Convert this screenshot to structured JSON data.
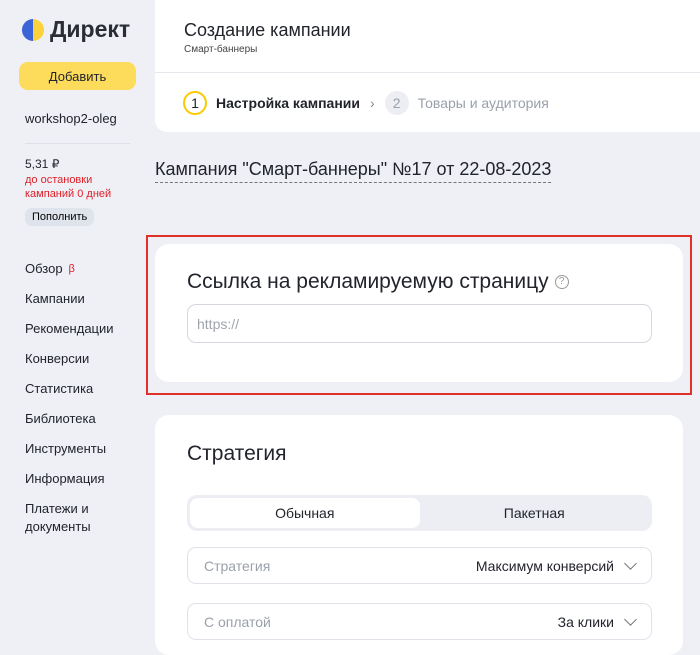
{
  "sidebar": {
    "logo": "Директ",
    "add": "Добавить",
    "login": "workshop2-oleg",
    "balance": "5,31 ₽",
    "warning": "до остановки кампаний 0 дней",
    "topup": "Пополнить",
    "nav": [
      "Обзор",
      "Кампании",
      "Рекомендации",
      "Конверсии",
      "Статистика",
      "Библиотека",
      "Инструменты",
      "Информация",
      "Платежи и документы"
    ],
    "beta": "β"
  },
  "header": {
    "title": "Создание кампании",
    "subtitle": "Смарт-баннеры",
    "steps": [
      {
        "num": "1",
        "label": "Настройка кампании"
      },
      {
        "num": "2",
        "label": "Товары и аудитория"
      }
    ]
  },
  "campaign_name": "Кампания \"Смарт-баннеры\" №17 от 22-08-2023",
  "link_card": {
    "title": "Ссылка на рекламируемую страницу",
    "help": "?",
    "placeholder": "https://",
    "value": ""
  },
  "strategy": {
    "title": "Стратегия",
    "tabs": [
      "Обычная",
      "Пакетная"
    ],
    "strategy_label": "Стратегия",
    "strategy_value": "Максимум конверсий",
    "payment_label": "С оплатой",
    "payment_value": "За клики"
  }
}
